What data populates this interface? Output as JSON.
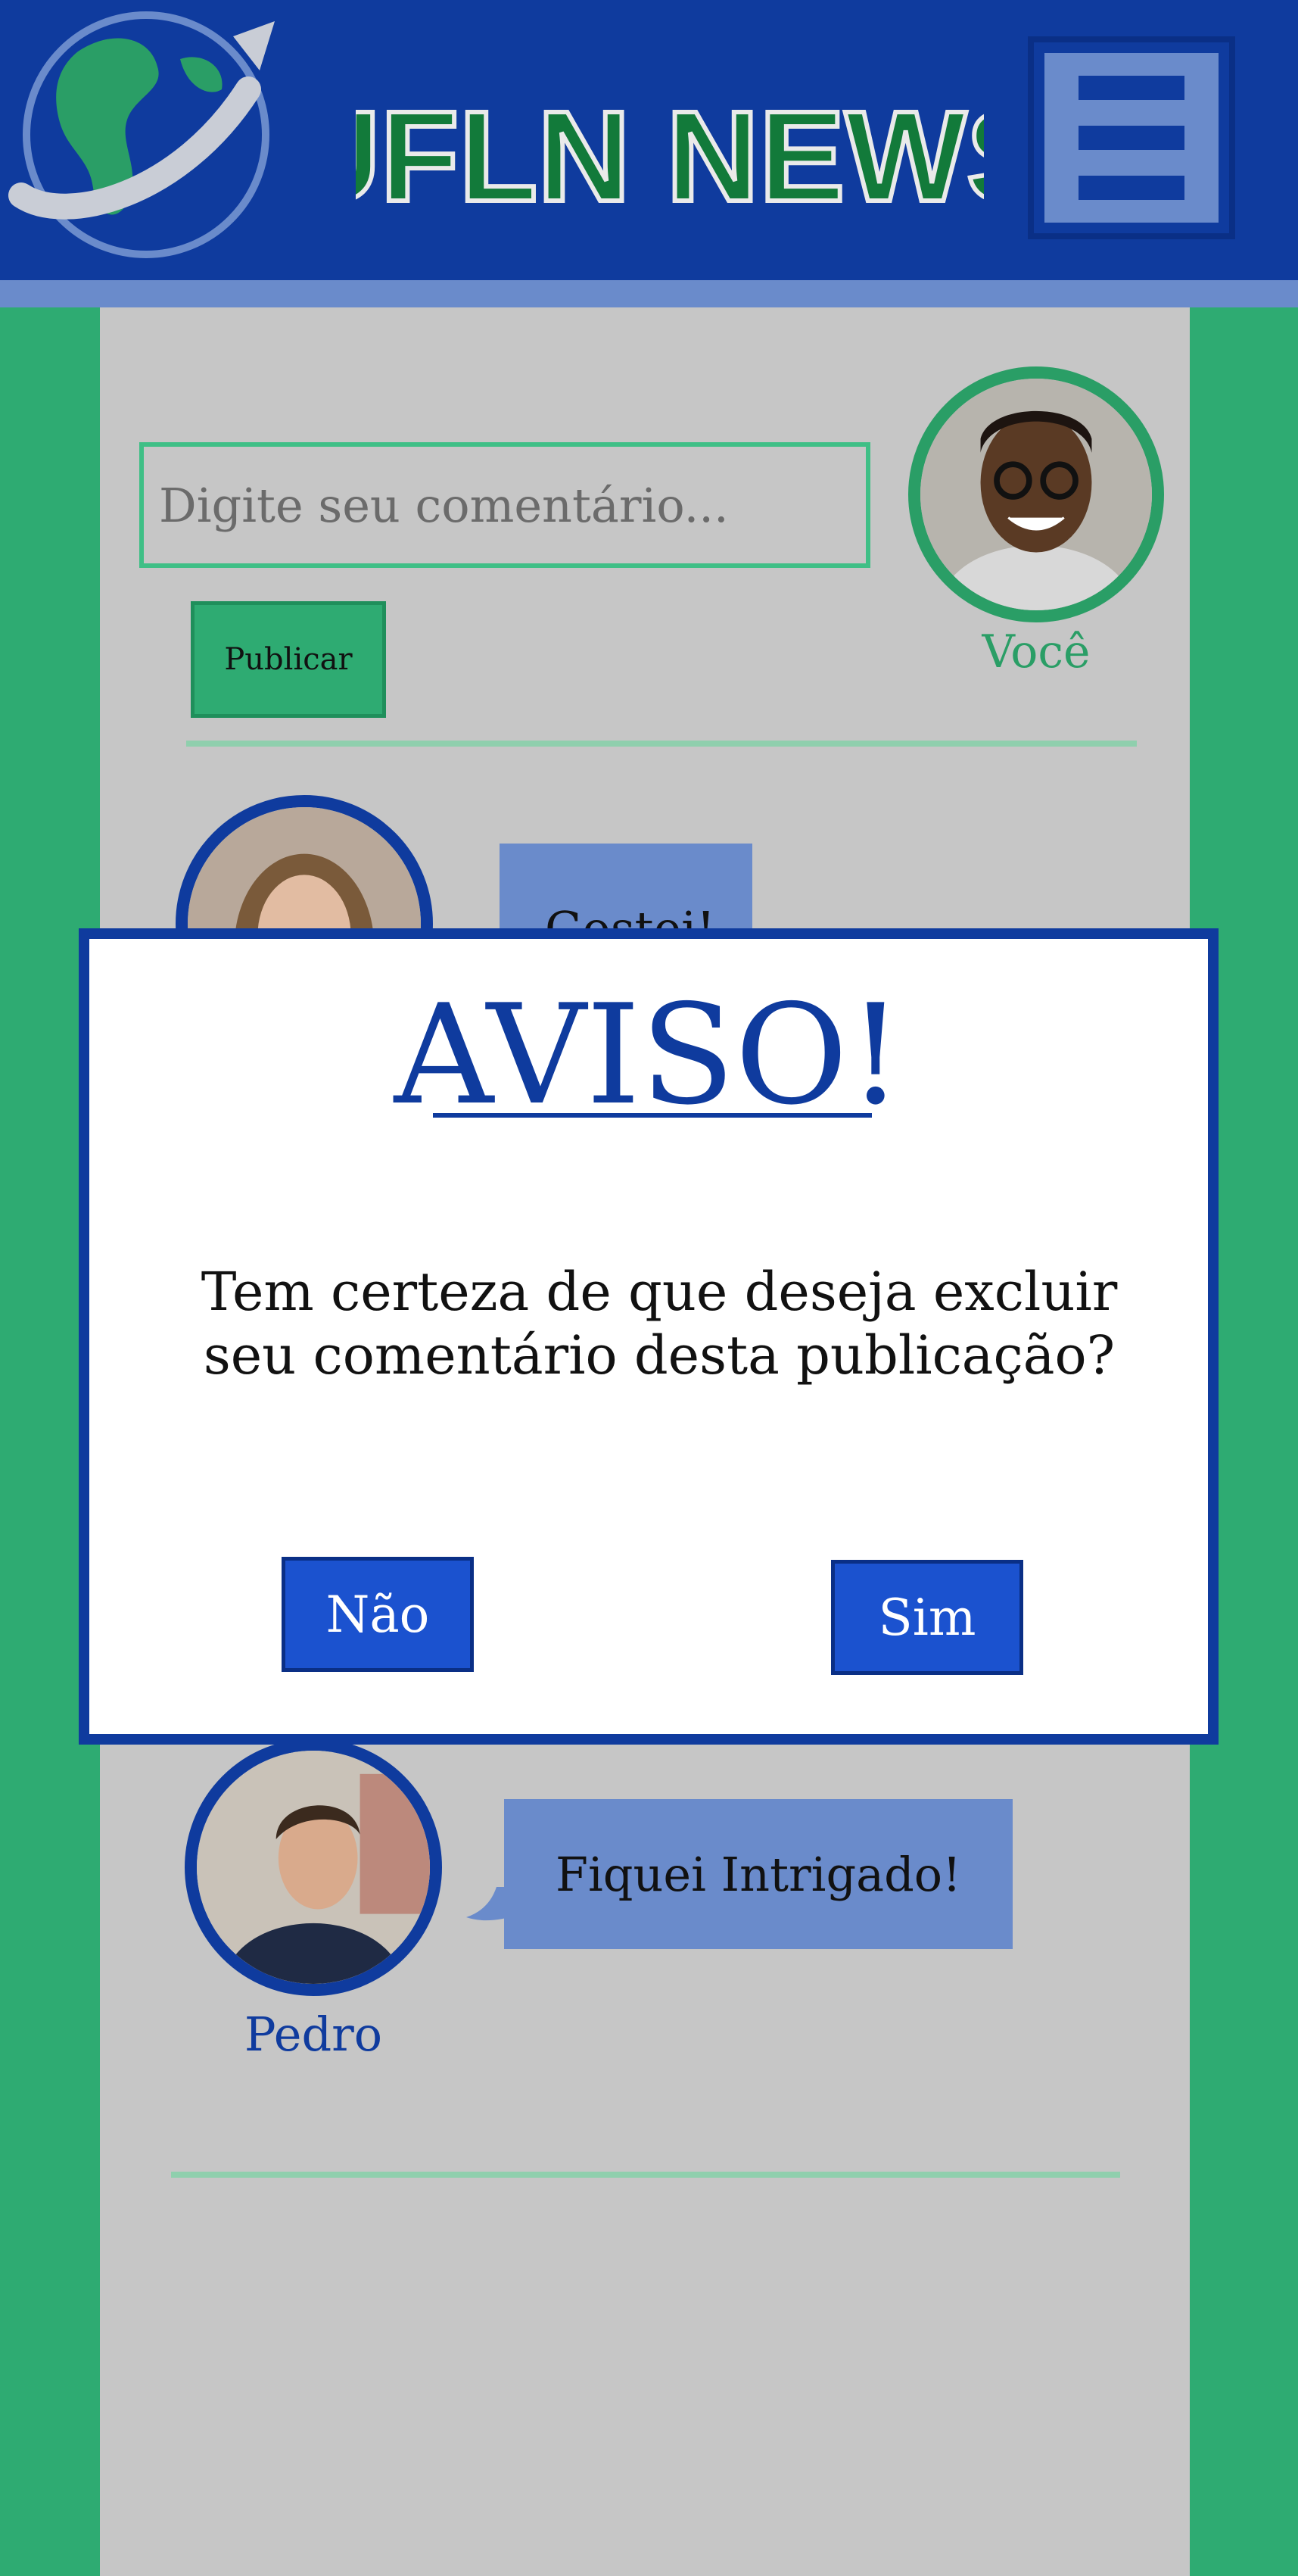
{
  "header": {
    "brand": "UFLN NEWS",
    "menu_icon": "hamburger-menu-icon",
    "colors": {
      "header": "#0f3b9e",
      "accent": "#6a8bcb",
      "brand": "#127a3a"
    }
  },
  "composer": {
    "placeholder": "Digite seu comentário...",
    "publish_label": "Publicar",
    "user_label": "Você"
  },
  "comments": [
    {
      "author": "",
      "text": "Gostei!"
    },
    {
      "author": "Pedro",
      "text": "Fiquei Intrigado!"
    }
  ],
  "modal": {
    "title": "AVISO!",
    "message_line1": "Tem certeza de que deseja excluir",
    "message_line2": "seu comentário desta publicação?",
    "no_label": "Não",
    "yes_label": "Sim"
  }
}
